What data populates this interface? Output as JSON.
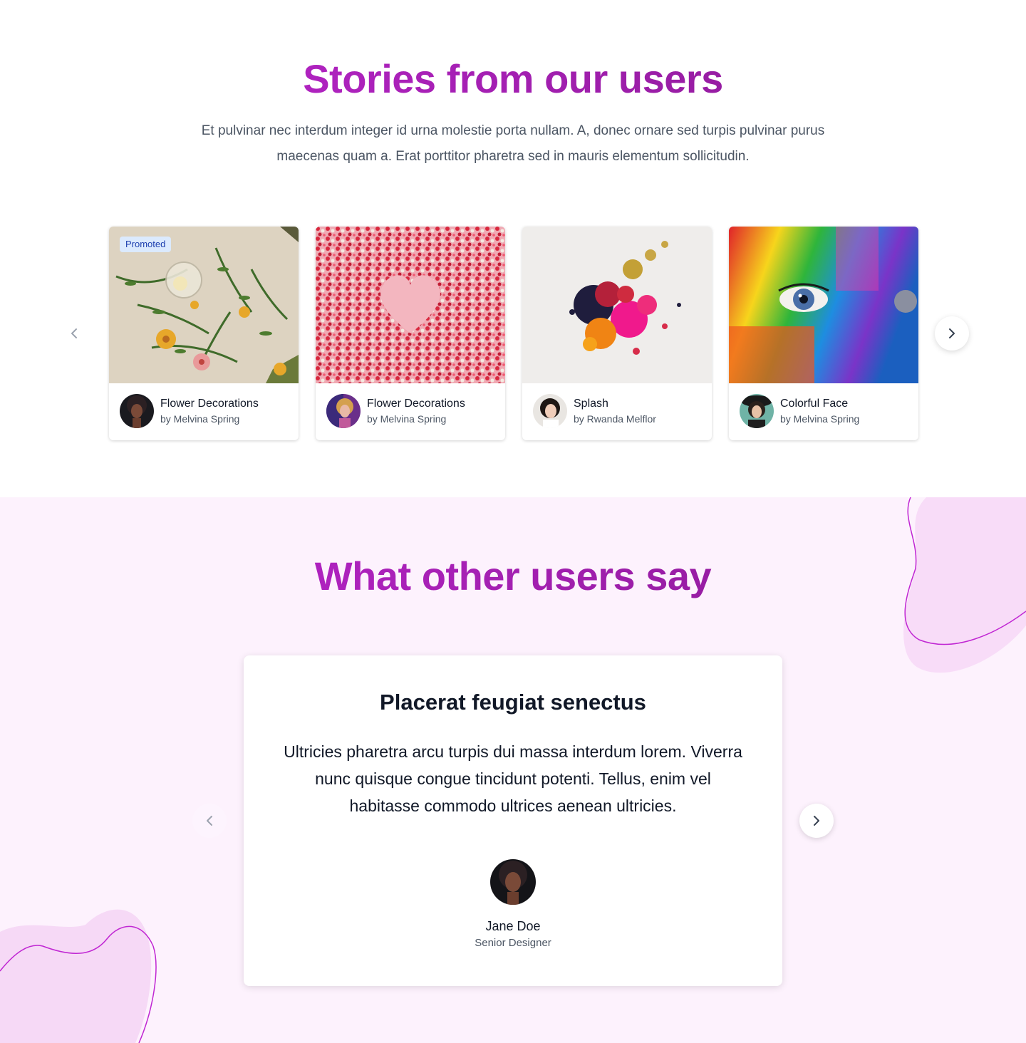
{
  "stories": {
    "title": "Stories from our users",
    "lede": "Et pulvinar nec interdum integer id urna molestie porta nullam. A, donec ornare sed turpis pulvinar purus maecenas quam a. Erat porttitor pharetra sed in mauris elementum sollicitudin.",
    "cards": [
      {
        "badge": "Promoted",
        "title": "Flower Decorations",
        "author": "by Melvina Spring",
        "image_icon": "flowers-image",
        "avatar_icon": "avatar-image"
      },
      {
        "badge": "",
        "title": "Flower Decorations",
        "author": "by Melvina Spring",
        "image_icon": "heart-sprinkles-image",
        "avatar_icon": "avatar-image"
      },
      {
        "badge": "",
        "title": "Splash",
        "author": "by Rwanda Melflor",
        "image_icon": "paint-splash-image",
        "avatar_icon": "avatar-image"
      },
      {
        "badge": "",
        "title": "Colorful Face",
        "author": "by Melvina Spring",
        "image_icon": "colorful-face-image",
        "avatar_icon": "avatar-image"
      }
    ]
  },
  "testimonials": {
    "title": "What other users say",
    "card": {
      "title": "Placerat feugiat senectus",
      "quote": "Ultricies pharetra arcu turpis dui massa interdum lorem. Viverra nunc quisque congue tincidunt potenti. Tellus, enim vel habitasse commodo ultrices aenean ultricies.",
      "name": "Jane Doe",
      "role": "Senior Designer"
    }
  },
  "colors": {
    "gradient_start": "#c026d3",
    "gradient_end": "#86198f",
    "testimonial_bg": "#fdf2fd",
    "badge_bg": "#dbeafe",
    "badge_text": "#1e40af"
  }
}
